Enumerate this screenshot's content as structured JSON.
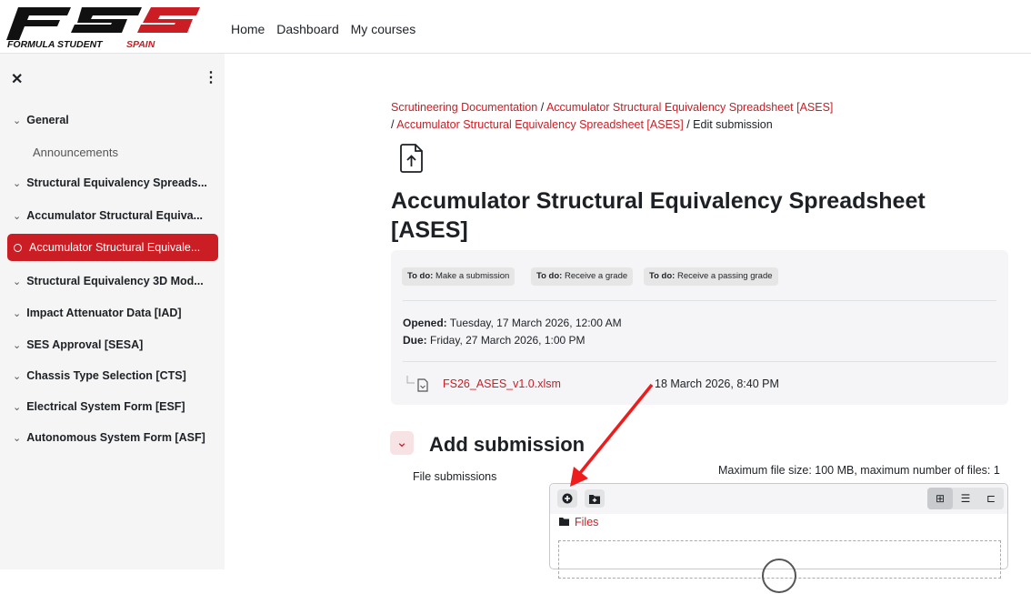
{
  "brand": {
    "logo_text": "FSS",
    "tagline_a": "FORMULA STUDENT",
    "tagline_b": "SPAIN",
    "accent": "#ca1d24"
  },
  "topnav": [
    "Home",
    "Dashboard",
    "My courses"
  ],
  "drawer": {
    "close_icon": "close-icon",
    "menu_icon": "kebab-icon",
    "items": [
      {
        "label": "General",
        "type": "section"
      },
      {
        "label": "Announcements",
        "type": "sub"
      },
      {
        "label": "Structural Equivalency Spreads...",
        "type": "section"
      },
      {
        "label": "Accumulator Structural Equiva...",
        "type": "section"
      },
      {
        "label": "Accumulator Structural Equivale...",
        "type": "active"
      },
      {
        "label": "Structural Equivalency 3D Mod...",
        "type": "section"
      },
      {
        "label": "Impact Attenuator Data [IAD]",
        "type": "section"
      },
      {
        "label": "SES Approval [SESA]",
        "type": "section"
      },
      {
        "label": "Chassis Type Selection [CTS]",
        "type": "section"
      },
      {
        "label": "Electrical System Form [ESF]",
        "type": "section"
      },
      {
        "label": "Autonomous System Form [ASF]",
        "type": "section"
      }
    ]
  },
  "breadcrumb": {
    "c1": "Scrutineering Documentation",
    "c2": "Accumulator Structural Equivalency Spreadsheet [ASES]",
    "c3": "Accumulator Structural Equivalency Spreadsheet [ASES]",
    "c4": "Edit submission",
    "sep": "/"
  },
  "page": {
    "title": "Accumulator Structural Equivalency Spreadsheet [ASES]"
  },
  "todo": [
    {
      "prefix": "To do:",
      "text": "Make a submission"
    },
    {
      "prefix": "To do:",
      "text": "Receive a grade"
    },
    {
      "prefix": "To do:",
      "text": "Receive a passing grade"
    }
  ],
  "dates": {
    "opened_label": "Opened:",
    "opened_value": "Tuesday, 17 March 2026, 12:00 AM",
    "due_label": "Due:",
    "due_value": "Friday, 27 March 2026, 1:00 PM"
  },
  "attachment": {
    "name": "FS26_ASES_v1.0.xlsm",
    "date": "18 March 2026, 8:40 PM"
  },
  "submission": {
    "heading": "Add submission",
    "field_label": "File submissions",
    "max_info": "Maximum file size: 100 MB, maximum number of files: 1",
    "folder_label": "Files"
  }
}
